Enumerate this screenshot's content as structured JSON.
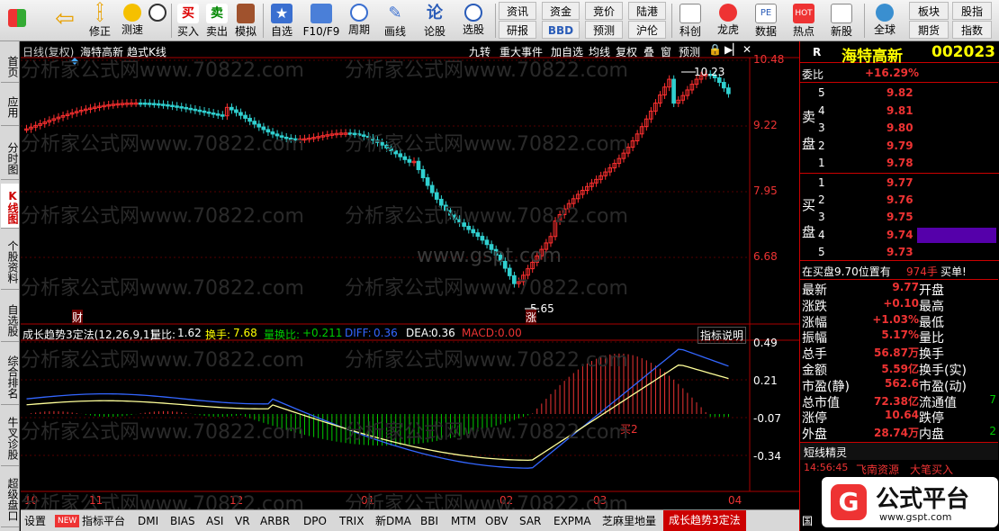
{
  "toolbar": {
    "left_buttons": [
      {
        "label": "",
        "icon": "windows-icon"
      },
      {
        "label": "",
        "icon": "back-arrow-icon"
      },
      {
        "label": "修正",
        "icon": "up-down-arrows-icon"
      },
      {
        "label": "测速",
        "icon": "speedometer-icon"
      },
      {
        "label": "买入",
        "icon": "buy-icon"
      },
      {
        "label": "卖出",
        "icon": "sell-icon"
      },
      {
        "label": "模拟",
        "icon": "gavel-icon"
      },
      {
        "label": "自选",
        "icon": "star-icon"
      },
      {
        "label": "F10/F9",
        "icon": "f10-icon"
      },
      {
        "label": "周期",
        "icon": "clock-icon"
      },
      {
        "label": "画线",
        "icon": "pencil-icon"
      },
      {
        "label": "论股",
        "icon": "lun-icon"
      },
      {
        "label": "选股",
        "icon": "target-icon"
      }
    ],
    "grid_buttons": [
      {
        "label": "资讯"
      },
      {
        "label": "资金"
      },
      {
        "label": "竞价"
      },
      {
        "label": "陆港"
      },
      {
        "label": "研报"
      },
      {
        "label": "BBD"
      },
      {
        "label": "预测"
      },
      {
        "label": "沪伦"
      }
    ],
    "right_buttons": [
      {
        "label": "科创",
        "icon": "chart-icon"
      },
      {
        "label": "龙虎",
        "icon": "dragon-icon"
      },
      {
        "label": "数据",
        "icon": "pe-icon"
      },
      {
        "label": "热点",
        "icon": "hot-icon"
      },
      {
        "label": "新股",
        "icon": "news-icon"
      },
      {
        "label": "全球",
        "icon": "globe-icon"
      }
    ],
    "extra_buttons": [
      {
        "label": "板块"
      },
      {
        "label": "股指"
      },
      {
        "label": "期货"
      },
      {
        "label": "指数"
      }
    ]
  },
  "sidebar": {
    "tabs": [
      {
        "label": "首页",
        "active": false
      },
      {
        "label": "应用",
        "active": false
      },
      {
        "label": "分时图",
        "active": false
      },
      {
        "label": "K线图",
        "active": true
      },
      {
        "label": "个股资料",
        "active": false
      },
      {
        "label": "自选股",
        "active": false
      },
      {
        "label": "综合排名",
        "active": false
      },
      {
        "label": "牛叉诊股",
        "active": false
      },
      {
        "label": "超级盘口",
        "active": false
      }
    ]
  },
  "chart_header": {
    "period": "日线(复权)",
    "stock_name": "海特高新",
    "style": "趋式K线",
    "buttons": [
      "九转",
      "重大事件",
      "加自选",
      "均线",
      "复权",
      "叠",
      "窗",
      "预测"
    ]
  },
  "price_axis": [
    "10.48",
    "9.22",
    "7.95",
    "6.68"
  ],
  "price_marks": {
    "high_label": "10.23",
    "low_label": "5.65",
    "cai_tag": "财",
    "zhang_tag": "涨"
  },
  "indicator_header": {
    "name": "成长趋势3定法(12,26,9,1)",
    "liangbi_label": "量比:",
    "liangbi_value": "1.62",
    "huanshou_label": "换手:",
    "huanshou_value": "7.68",
    "lianghuanbi_label": "量换比:",
    "lianghuanbi_value": "+0.211",
    "diff_label": "DIFF:",
    "diff_value": "0.36",
    "dea_label": "DEA:",
    "dea_value": "0.36",
    "macd_label": "MACD:",
    "macd_value": "0.00",
    "explain_button": "指标说明",
    "buy_signal": "买2"
  },
  "indicator_axis": [
    "0.49",
    "0.21",
    "-0.07",
    "-0.34"
  ],
  "date_axis": [
    "10",
    "11",
    "12",
    "01",
    "02",
    "03",
    "04"
  ],
  "bottom_tabs": [
    "设置",
    "NEW",
    "指标平台",
    "DMI",
    "BIAS",
    "ASI",
    "VR",
    "ARBR",
    "DPO",
    "TRIX",
    "新DMA",
    "BBI",
    "MTM",
    "OBV",
    "SAR",
    "EXPMA",
    "芝麻里地量",
    "成长趋势3定法"
  ],
  "watermarks": [
    "分析家公式网www.70822.com",
    "www.gspt.com"
  ],
  "right_panel": {
    "r_label": "R",
    "stock_title": "海特高新",
    "stock_code": "002023",
    "weibi_label": "委比",
    "weibi_value": "+16.29%",
    "sell_label": "卖盘",
    "buy_label": "买盘",
    "sell": [
      {
        "level": "5",
        "price": "9.82"
      },
      {
        "level": "4",
        "price": "9.81"
      },
      {
        "level": "3",
        "price": "9.80"
      },
      {
        "level": "2",
        "price": "9.79"
      },
      {
        "level": "1",
        "price": "9.78"
      }
    ],
    "buy": [
      {
        "level": "1",
        "price": "9.77"
      },
      {
        "level": "2",
        "price": "9.76"
      },
      {
        "level": "3",
        "price": "9.75"
      },
      {
        "level": "4",
        "price": "9.74"
      },
      {
        "level": "5",
        "price": "9.73"
      }
    ],
    "zaimaipan_text": "在买盘9.70位置有",
    "zaimaipan_volume": "974手",
    "zaimaipan_action": "买单!",
    "stats": [
      {
        "label": "最新",
        "value": "9.77",
        "label2": "开盘",
        "value2": ""
      },
      {
        "label": "涨跌",
        "value": "+0.10",
        "label2": "最高",
        "value2": ""
      },
      {
        "label": "涨幅",
        "value": "+1.03%",
        "label2": "最低",
        "value2": ""
      },
      {
        "label": "振幅",
        "value": "5.17%",
        "label2": "量比",
        "value2": ""
      },
      {
        "label": "总手",
        "value": "56.87万",
        "label2": "换手",
        "value2": ""
      },
      {
        "label": "金额",
        "value": "5.59亿",
        "label2": "换手(实)",
        "value2": ""
      },
      {
        "label": "市盈(静)",
        "value": "562.6",
        "label2": "市盈(动)",
        "value2": ""
      },
      {
        "label": "总市值",
        "value": "72.38亿",
        "label2": "流通值",
        "value2": "7"
      },
      {
        "label": "涨停",
        "value": "10.64",
        "label2": "跌停",
        "value2": ""
      },
      {
        "label": "外盘",
        "value": "28.74万",
        "label2": "内盘",
        "value2": "2"
      }
    ],
    "elf_title": "短线精灵",
    "elf_time": "14:56:45",
    "elf_name": "飞南资源",
    "elf_action": "大笔买入",
    "logo_text": "公式平台",
    "logo_url": "www.gspt.com",
    "bottom_glyph": "国"
  }
}
